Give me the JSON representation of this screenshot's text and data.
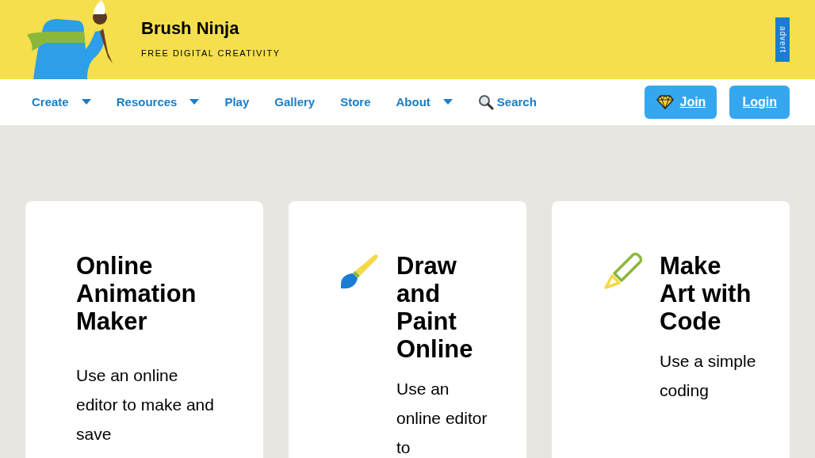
{
  "header": {
    "title": "Brush Ninja",
    "tagline": "FREE DIGITAL CREATIVITY",
    "advert": "advert"
  },
  "nav": {
    "items": [
      {
        "label": "Create",
        "kind": "dropdown"
      },
      {
        "label": "Resources",
        "kind": "dropdown"
      },
      {
        "label": "Play",
        "kind": "link"
      },
      {
        "label": "Gallery",
        "kind": "link"
      },
      {
        "label": "Store",
        "kind": "link"
      },
      {
        "label": "About",
        "kind": "dropdown"
      },
      {
        "label": "Search",
        "kind": "search"
      }
    ],
    "buttons": [
      {
        "label": "Join",
        "kind": "join"
      },
      {
        "label": "Login",
        "kind": "login"
      }
    ]
  },
  "cards": [
    {
      "kind": "plain",
      "title": "Online Animation Maker",
      "text": "Use an online editor to make and save"
    },
    {
      "kind": "brush",
      "title": "Draw and Paint Online",
      "text": "Use an online editor to"
    },
    {
      "kind": "pencil",
      "title": "Make Art with Code",
      "text": "Use a simple coding"
    }
  ]
}
